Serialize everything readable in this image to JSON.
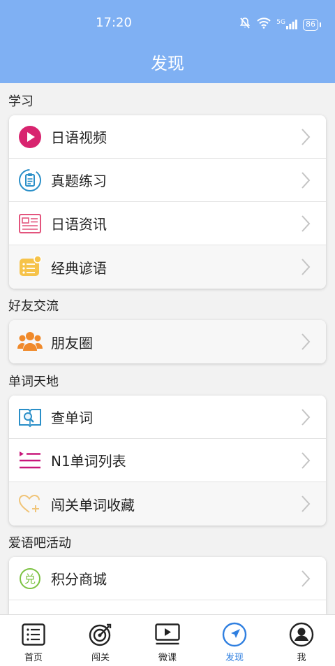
{
  "status_bar": {
    "time": "17:20",
    "battery": "86",
    "signal_text": "5G"
  },
  "header": {
    "title": "发现"
  },
  "sections": [
    {
      "title": "学习",
      "items": [
        {
          "label": "日语视频",
          "icon": "play-icon"
        },
        {
          "label": "真题练习",
          "icon": "exam-icon"
        },
        {
          "label": "日语资讯",
          "icon": "news-icon"
        },
        {
          "label": "经典谚语",
          "icon": "proverb-icon"
        }
      ]
    },
    {
      "title": "好友交流",
      "items": [
        {
          "label": "朋友圈",
          "icon": "friends-icon"
        }
      ]
    },
    {
      "title": "单词天地",
      "items": [
        {
          "label": "查单词",
          "icon": "dictionary-search-icon"
        },
        {
          "label": "N1单词列表",
          "icon": "list-icon"
        },
        {
          "label": "闯关单词收藏",
          "icon": "heart-add-icon"
        }
      ]
    },
    {
      "title": "爱语吧活动",
      "items": [
        {
          "label": "积分商城",
          "icon": "exchange-icon"
        }
      ]
    }
  ],
  "tabs": [
    {
      "label": "首页",
      "icon": "home-list-icon",
      "active": false
    },
    {
      "label": "闯关",
      "icon": "target-icon",
      "active": false
    },
    {
      "label": "微课",
      "icon": "video-icon",
      "active": false
    },
    {
      "label": "发现",
      "icon": "compass-icon",
      "active": true
    },
    {
      "label": "我",
      "icon": "user-icon",
      "active": false
    }
  ],
  "colors": {
    "header_bg": "#7fb0f3",
    "active_tab": "#2f7fe0",
    "play": "#d8246f",
    "exam": "#2a8fc8",
    "news": "#e3547d",
    "proverb": "#f6c34a",
    "friends": "#f08a2b",
    "list": "#c8177a"
  }
}
